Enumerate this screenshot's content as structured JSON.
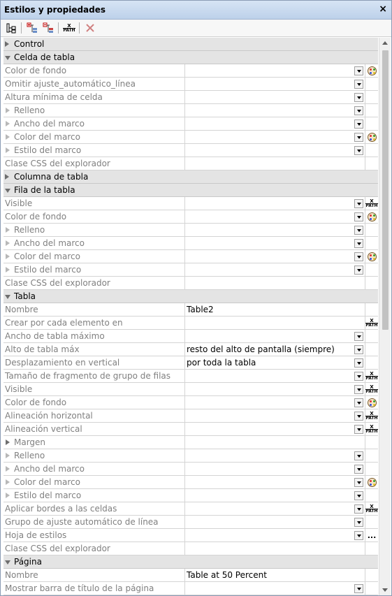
{
  "window": {
    "title": "Estilos y propiedades",
    "close_symbol": "×"
  },
  "toolbar": {
    "buttons": [
      {
        "icon": "tree-view-icon"
      },
      {
        "icon": "expand-all-icon"
      },
      {
        "icon": "collapse-all-icon"
      },
      {
        "icon": "xpath-icon"
      },
      {
        "icon": "delete-icon",
        "disabled": true
      }
    ]
  },
  "grid": {
    "rows": [
      {
        "kind": "group",
        "expanded": false,
        "label": "Control"
      },
      {
        "kind": "group",
        "expanded": true,
        "label": "Celda de tabla"
      },
      {
        "kind": "prop",
        "label": "Color de fondo",
        "value": "",
        "dropdown": true,
        "button": "palette"
      },
      {
        "kind": "prop",
        "label": "Omitir ajuste_automático_línea",
        "value": "",
        "dropdown": true,
        "button": ""
      },
      {
        "kind": "prop",
        "label": "Altura mínima de celda",
        "value": "",
        "dropdown": true,
        "button": ""
      },
      {
        "kind": "prop",
        "sub": true,
        "label": "Relleno",
        "value": "",
        "dropdown": true,
        "button": ""
      },
      {
        "kind": "prop",
        "sub": true,
        "label": "Ancho del marco",
        "value": "",
        "dropdown": true,
        "button": ""
      },
      {
        "kind": "prop",
        "sub": true,
        "label": "Color del marco",
        "value": "",
        "dropdown": true,
        "button": "palette"
      },
      {
        "kind": "prop",
        "sub": true,
        "label": "Estilo del marco",
        "value": "",
        "dropdown": true,
        "button": ""
      },
      {
        "kind": "prop",
        "label": "Clase CSS del explorador",
        "value": "",
        "dropdown": false,
        "button": ""
      },
      {
        "kind": "group",
        "expanded": false,
        "label": "Columna de tabla"
      },
      {
        "kind": "group",
        "expanded": true,
        "label": "Fila de la tabla"
      },
      {
        "kind": "prop",
        "label": "Visible",
        "value": "",
        "dropdown": true,
        "button": "xpath"
      },
      {
        "kind": "prop",
        "label": "Color de fondo",
        "value": "",
        "dropdown": true,
        "button": "palette"
      },
      {
        "kind": "prop",
        "sub": true,
        "label": "Relleno",
        "value": "",
        "dropdown": true,
        "button": ""
      },
      {
        "kind": "prop",
        "sub": true,
        "label": "Ancho del marco",
        "value": "",
        "dropdown": true,
        "button": ""
      },
      {
        "kind": "prop",
        "sub": true,
        "label": "Color del marco",
        "value": "",
        "dropdown": true,
        "button": "palette"
      },
      {
        "kind": "prop",
        "sub": true,
        "label": "Estilo del marco",
        "value": "",
        "dropdown": true,
        "button": ""
      },
      {
        "kind": "prop",
        "label": "Clase CSS del explorador",
        "value": "",
        "dropdown": false,
        "button": ""
      },
      {
        "kind": "group",
        "expanded": true,
        "label": "Tabla"
      },
      {
        "kind": "prop",
        "label": "Nombre",
        "value": "Table2",
        "dropdown": false,
        "button": ""
      },
      {
        "kind": "prop",
        "label": "Crear por cada elemento en",
        "value": "",
        "dropdown": false,
        "button": "xpath"
      },
      {
        "kind": "prop",
        "label": "Ancho de tabla máximo",
        "value": "",
        "dropdown": true,
        "button": ""
      },
      {
        "kind": "prop",
        "label": "Alto de tabla máx",
        "value": "resto del alto de pantalla (siempre)",
        "dropdown": true,
        "button": ""
      },
      {
        "kind": "prop",
        "label": "Desplazamiento en vertical",
        "value": "por toda la tabla",
        "dropdown": true,
        "button": ""
      },
      {
        "kind": "prop",
        "label": "Tamaño de fragmento de grupo de filas",
        "value": "",
        "dropdown": true,
        "button": "xpath"
      },
      {
        "kind": "prop",
        "label": "Visible",
        "value": "",
        "dropdown": true,
        "button": "xpath"
      },
      {
        "kind": "prop",
        "label": "Color de fondo",
        "value": "",
        "dropdown": true,
        "button": "palette"
      },
      {
        "kind": "prop",
        "label": "Alineación horizontal",
        "value": "",
        "dropdown": true,
        "button": "xpath"
      },
      {
        "kind": "prop",
        "label": "Alineación vertical",
        "value": "",
        "dropdown": true,
        "button": "xpath"
      },
      {
        "kind": "prop",
        "sub": true,
        "strong_arrow": true,
        "label": "Margen",
        "value": "",
        "dropdown": false,
        "button": ""
      },
      {
        "kind": "prop",
        "sub": true,
        "label": "Relleno",
        "value": "",
        "dropdown": true,
        "button": ""
      },
      {
        "kind": "prop",
        "sub": true,
        "label": "Ancho del marco",
        "value": "",
        "dropdown": true,
        "button": ""
      },
      {
        "kind": "prop",
        "sub": true,
        "label": "Color del marco",
        "value": "",
        "dropdown": true,
        "button": "palette"
      },
      {
        "kind": "prop",
        "sub": true,
        "label": "Estilo del marco",
        "value": "",
        "dropdown": true,
        "button": ""
      },
      {
        "kind": "prop",
        "label": "Aplicar bordes a las celdas",
        "value": "",
        "dropdown": true,
        "button": "xpath"
      },
      {
        "kind": "prop",
        "label": "Grupo de ajuste automático de línea",
        "value": "",
        "dropdown": true,
        "button": ""
      },
      {
        "kind": "prop",
        "label": "Hoja de estilos",
        "value": "",
        "dropdown": true,
        "button": "ellipsis"
      },
      {
        "kind": "prop",
        "label": "Clase CSS del explorador",
        "value": "",
        "dropdown": false,
        "button": ""
      },
      {
        "kind": "group",
        "expanded": true,
        "label": "Página"
      },
      {
        "kind": "prop",
        "label": "Nombre",
        "value": "Table at 50 Percent",
        "dropdown": false,
        "button": ""
      },
      {
        "kind": "prop",
        "label": "Mostrar barra de título de la página",
        "value": "",
        "dropdown": true,
        "button": ""
      }
    ]
  },
  "xpath_icon_text": {
    "top": "X",
    "bottom": "PATH"
  },
  "ellipsis_text": "...",
  "colors": {
    "group_bg": "#e4e4e4",
    "label_gray": "#808080",
    "title_gradient_top": "#d7e4f4",
    "delete_disabled": "#d08080"
  }
}
